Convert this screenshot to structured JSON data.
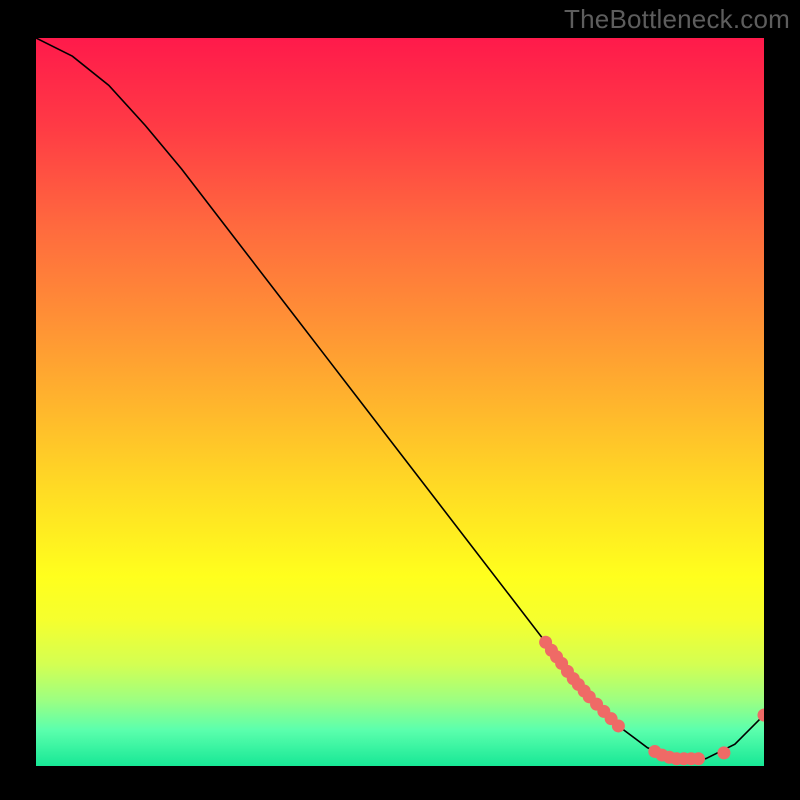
{
  "watermark": "TheBottleneck.com",
  "colors": {
    "dot": "#ef6a66",
    "line": "#000000",
    "background": "#000000"
  },
  "chart_data": {
    "type": "line",
    "title": "",
    "xlabel": "",
    "ylabel": "",
    "xlim": [
      0,
      100
    ],
    "ylim": [
      0,
      100
    ],
    "series": [
      {
        "name": "curve",
        "x": [
          0,
          5,
          10,
          15,
          20,
          25,
          30,
          35,
          40,
          45,
          50,
          55,
          60,
          65,
          70,
          73,
          76,
          80,
          84,
          88,
          92,
          96,
          100
        ],
        "y": [
          100,
          97.5,
          93.5,
          88,
          82,
          75.5,
          69,
          62.5,
          56,
          49.5,
          43,
          36.5,
          30,
          23.5,
          17,
          13,
          9.5,
          5.5,
          2.5,
          1,
          1,
          3,
          7
        ]
      }
    ],
    "highlight_points": {
      "name": "dots",
      "points": [
        {
          "x": 70.0,
          "y": 17.0
        },
        {
          "x": 70.8,
          "y": 15.9
        },
        {
          "x": 71.5,
          "y": 15.0
        },
        {
          "x": 72.2,
          "y": 14.1
        },
        {
          "x": 73.0,
          "y": 13.0
        },
        {
          "x": 73.8,
          "y": 12.0
        },
        {
          "x": 74.5,
          "y": 11.2
        },
        {
          "x": 75.3,
          "y": 10.3
        },
        {
          "x": 76.0,
          "y": 9.5
        },
        {
          "x": 77.0,
          "y": 8.5
        },
        {
          "x": 78.0,
          "y": 7.5
        },
        {
          "x": 79.0,
          "y": 6.5
        },
        {
          "x": 80.0,
          "y": 5.5
        },
        {
          "x": 85.0,
          "y": 2.0
        },
        {
          "x": 86.0,
          "y": 1.5
        },
        {
          "x": 87.0,
          "y": 1.2
        },
        {
          "x": 88.0,
          "y": 1.0
        },
        {
          "x": 89.0,
          "y": 1.0
        },
        {
          "x": 90.0,
          "y": 1.0
        },
        {
          "x": 91.0,
          "y": 1.0
        },
        {
          "x": 94.5,
          "y": 1.8
        },
        {
          "x": 100.0,
          "y": 7.0
        }
      ]
    }
  }
}
